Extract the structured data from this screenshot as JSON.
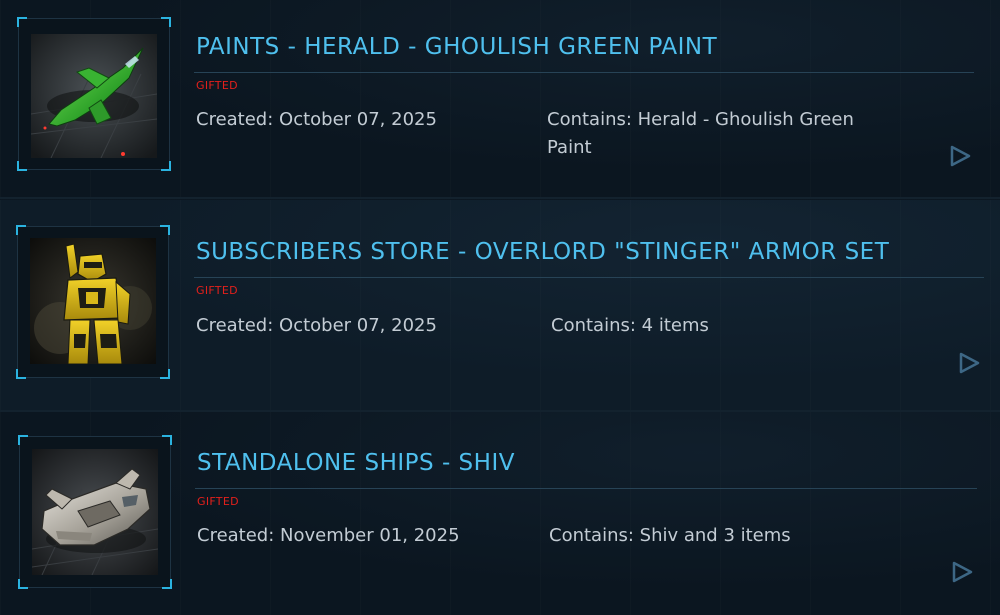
{
  "pledges": [
    {
      "title": "PAINTS - HERALD - GHOULISH GREEN PAINT",
      "badge": "GIFTED",
      "created": "Created: October 07, 2025",
      "contains": "Contains: Herald - Ghoulish Green Paint",
      "thumbnail_icon": "ship-herald-green-icon"
    },
    {
      "title": "SUBSCRIBERS STORE - OVERLORD \"STINGER\" ARMOR SET",
      "badge": "GIFTED",
      "created": "Created: October 07, 2025",
      "contains": "Contains: 4 items",
      "thumbnail_icon": "armor-stinger-icon"
    },
    {
      "title": "STANDALONE SHIPS - SHIV",
      "badge": "GIFTED",
      "created": "Created: November 01, 2025",
      "contains": "Contains: Shiv and 3 items",
      "thumbnail_icon": "ship-shiv-icon"
    }
  ],
  "colors": {
    "title": "#4fc0ee",
    "badge": "#e2201c",
    "meta_text": "#c3ccd4",
    "frame_corner": "#2bb3e0",
    "arrow": "#3d6785"
  },
  "icons": {
    "expand": "play-triangle-icon"
  }
}
